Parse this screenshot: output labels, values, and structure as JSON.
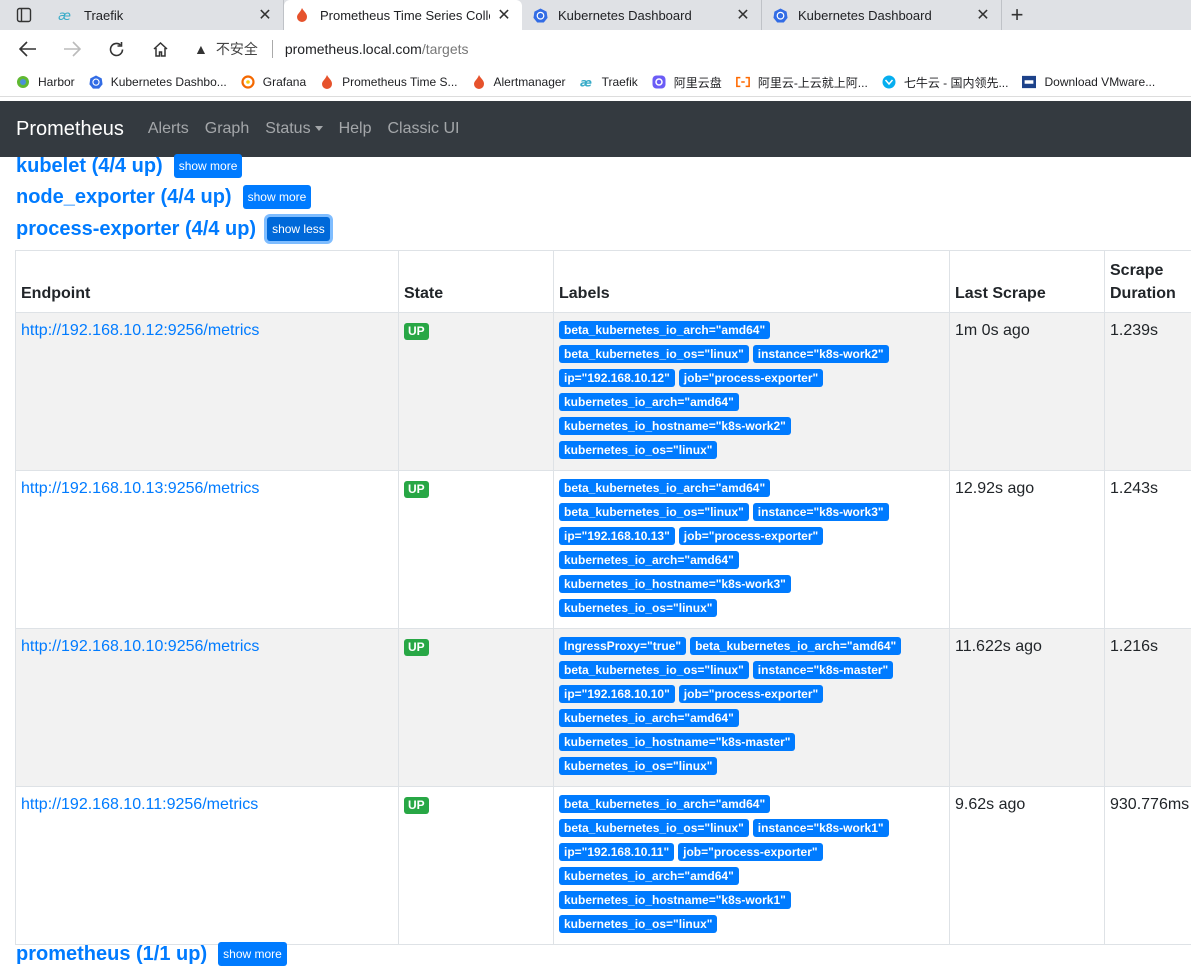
{
  "browser": {
    "tabs": [
      {
        "title": "Traefik",
        "icon": "traefik-icon"
      },
      {
        "title": "Prometheus Time Series Collectio",
        "icon": "prometheus-icon"
      },
      {
        "title": "Kubernetes Dashboard",
        "icon": "kubernetes-icon"
      },
      {
        "title": "Kubernetes Dashboard",
        "icon": "kubernetes-icon"
      }
    ],
    "address": {
      "warning": "不安全",
      "host": "prometheus.local.com",
      "path": "/targets"
    },
    "bookmarks": [
      {
        "label": "Harbor"
      },
      {
        "label": "Kubernetes Dashbo..."
      },
      {
        "label": "Grafana"
      },
      {
        "label": "Prometheus Time S..."
      },
      {
        "label": "Alertmanager"
      },
      {
        "label": "Traefik"
      },
      {
        "label": "阿里云盘"
      },
      {
        "label": "阿里云-上云就上阿..."
      },
      {
        "label": "七牛云 - 国内领先..."
      },
      {
        "label": "Download VMware..."
      }
    ]
  },
  "nav": {
    "brand": "Prometheus",
    "links": [
      "Alerts",
      "Graph",
      "Status",
      "Help",
      "Classic UI"
    ]
  },
  "sections": [
    {
      "title": "kubelet (4/4 up)",
      "button": "show more"
    },
    {
      "title": "node_exporter (4/4 up)",
      "button": "show more"
    },
    {
      "title": "process-exporter (4/4 up)",
      "button": "show less"
    },
    {
      "title": "prometheus (1/1 up)",
      "button": "show more"
    }
  ],
  "table": {
    "headers": [
      "Endpoint",
      "State",
      "Labels",
      "Last Scrape",
      "Scrape",
      "Duration"
    ],
    "rows": [
      {
        "endpoint": "http://192.168.10.12:9256/metrics",
        "state": "UP",
        "labels": [
          "beta_kubernetes_io_arch=\"amd64\"",
          "beta_kubernetes_io_os=\"linux\"",
          "instance=\"k8s-work2\"",
          "ip=\"192.168.10.12\"",
          "job=\"process-exporter\"",
          "kubernetes_io_arch=\"amd64\"",
          "kubernetes_io_hostname=\"k8s-work2\"",
          "kubernetes_io_os=\"linux\""
        ],
        "last_scrape": "1m 0s ago",
        "duration": "1.239s"
      },
      {
        "endpoint": "http://192.168.10.13:9256/metrics",
        "state": "UP",
        "labels": [
          "beta_kubernetes_io_arch=\"amd64\"",
          "beta_kubernetes_io_os=\"linux\"",
          "instance=\"k8s-work3\"",
          "ip=\"192.168.10.13\"",
          "job=\"process-exporter\"",
          "kubernetes_io_arch=\"amd64\"",
          "kubernetes_io_hostname=\"k8s-work3\"",
          "kubernetes_io_os=\"linux\""
        ],
        "last_scrape": "12.92s ago",
        "duration": "1.243s"
      },
      {
        "endpoint": "http://192.168.10.10:9256/metrics",
        "state": "UP",
        "labels": [
          "IngressProxy=\"true\"",
          "beta_kubernetes_io_arch=\"amd64\"",
          "beta_kubernetes_io_os=\"linux\"",
          "instance=\"k8s-master\"",
          "ip=\"192.168.10.10\"",
          "job=\"process-exporter\"",
          "kubernetes_io_arch=\"amd64\"",
          "kubernetes_io_hostname=\"k8s-master\"",
          "kubernetes_io_os=\"linux\""
        ],
        "last_scrape": "11.622s ago",
        "duration": "1.216s"
      },
      {
        "endpoint": "http://192.168.10.11:9256/metrics",
        "state": "UP",
        "labels": [
          "beta_kubernetes_io_arch=\"amd64\"",
          "beta_kubernetes_io_os=\"linux\"",
          "instance=\"k8s-work1\"",
          "ip=\"192.168.10.11\"",
          "job=\"process-exporter\"",
          "kubernetes_io_arch=\"amd64\"",
          "kubernetes_io_hostname=\"k8s-work1\"",
          "kubernetes_io_os=\"linux\""
        ],
        "last_scrape": "9.62s ago",
        "duration": "930.776ms"
      }
    ]
  },
  "colors": {
    "link": "#007bff",
    "up": "#28a745",
    "navbar": "#343a40"
  }
}
